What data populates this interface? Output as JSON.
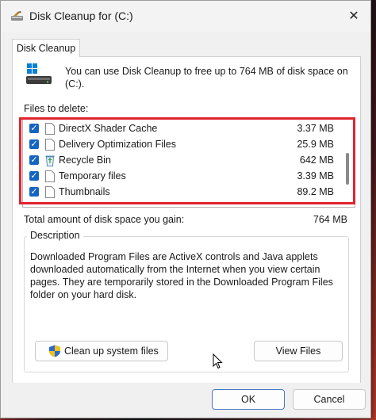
{
  "window": {
    "title": "Disk Cleanup for  (C:)",
    "close_glyph": "✕",
    "icon": "disk-cleanup-icon"
  },
  "tab": {
    "label": "Disk Cleanup"
  },
  "intro": {
    "text": "You can use Disk Cleanup to free up to 764 MB of disk space on (C:).",
    "icon": "windows-drive-icon"
  },
  "files_to_delete": {
    "label": "Files to delete:",
    "items": [
      {
        "name": "DirectX Shader Cache",
        "size": "3.37 MB",
        "checked": true,
        "icon": "file-icon"
      },
      {
        "name": "Delivery Optimization Files",
        "size": "25.9 MB",
        "checked": true,
        "icon": "file-icon"
      },
      {
        "name": "Recycle Bin",
        "size": "642 MB",
        "checked": true,
        "icon": "recycle-bin-icon"
      },
      {
        "name": "Temporary files",
        "size": "3.39 MB",
        "checked": true,
        "icon": "file-icon"
      },
      {
        "name": "Thumbnails",
        "size": "89.2 MB",
        "checked": true,
        "icon": "file-icon"
      }
    ],
    "check_glyph": "✓"
  },
  "total": {
    "label": "Total amount of disk space you gain:",
    "value": "764 MB"
  },
  "description": {
    "legend": "Description",
    "text": "Downloaded Program Files are ActiveX controls and Java applets downloaded automatically from the Internet when you view certain pages. They are temporarily stored in the Downloaded Program Files folder on your hard disk."
  },
  "buttons": {
    "cleanup_system": "Clean up system files",
    "view_files": "View Files",
    "ok": "OK",
    "cancel": "Cancel"
  },
  "colors": {
    "highlight": "#e0242e",
    "checkbox": "#1565c0",
    "accent_button_border": "#4a78c0"
  }
}
